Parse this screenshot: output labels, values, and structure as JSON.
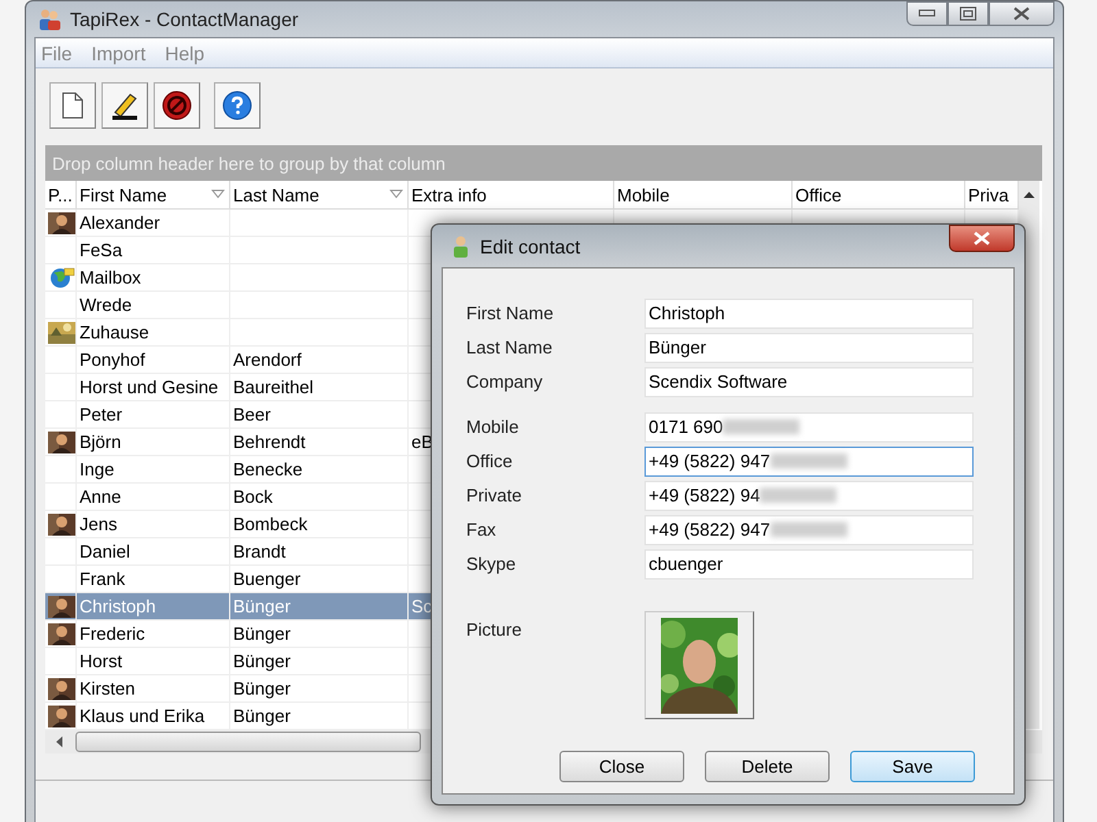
{
  "window": {
    "title": "TapiRex - ContactManager"
  },
  "menu": [
    "File",
    "Import",
    "Help"
  ],
  "toolbar": [
    {
      "kind": "new"
    },
    {
      "kind": "edit"
    },
    {
      "kind": "delete"
    },
    {
      "kind": "help"
    }
  ],
  "grid": {
    "group_hint": "Drop column header here to group by that column",
    "columns": [
      {
        "label": "P...",
        "filter": false
      },
      {
        "label": "First Name",
        "filter": true
      },
      {
        "label": "Last Name",
        "filter": true
      },
      {
        "label": "Extra info",
        "filter": false
      },
      {
        "label": "Mobile",
        "filter": false
      },
      {
        "label": "Office",
        "filter": false
      },
      {
        "label": "Priva",
        "filter": false
      }
    ],
    "rows": [
      {
        "kind": "person",
        "first_name": "Alexander",
        "selected": false
      },
      {
        "kind": "plain",
        "first_name": "FeSa",
        "selected": false
      },
      {
        "kind": "globe",
        "first_name": "Mailbox",
        "selected": false
      },
      {
        "kind": "plain",
        "first_name": "Wrede",
        "selected": false
      },
      {
        "kind": "scene",
        "first_name": "Zuhause",
        "selected": false
      },
      {
        "kind": "plain",
        "first_name": "Ponyhof",
        "last_name": "Arendorf",
        "selected": false
      },
      {
        "kind": "plain",
        "first_name": "Horst und Gesine",
        "last_name": "Baureithel",
        "selected": false
      },
      {
        "kind": "plain",
        "first_name": "Peter",
        "last_name": "Beer",
        "selected": false
      },
      {
        "kind": "person",
        "first_name": "Björn",
        "last_name": "Behrendt",
        "extra_info": "eB",
        "selected": false
      },
      {
        "kind": "plain",
        "first_name": "Inge",
        "last_name": "Benecke",
        "selected": false
      },
      {
        "kind": "plain",
        "first_name": "Anne",
        "last_name": "Bock",
        "selected": false
      },
      {
        "kind": "person",
        "first_name": "Jens",
        "last_name": "Bombeck",
        "selected": false
      },
      {
        "kind": "plain",
        "first_name": "Daniel",
        "last_name": "Brandt",
        "selected": false
      },
      {
        "kind": "plain",
        "first_name": "Frank",
        "last_name": "Buenger",
        "selected": false
      },
      {
        "kind": "person",
        "first_name": "Christoph",
        "last_name": "Bünger",
        "extra_info": "Sc",
        "selected": true
      },
      {
        "kind": "person",
        "first_name": "Frederic",
        "last_name": "Bünger",
        "selected": false
      },
      {
        "kind": "plain",
        "first_name": "Horst",
        "last_name": "Bünger",
        "selected": false
      },
      {
        "kind": "person",
        "first_name": "Kirsten",
        "last_name": "Bünger",
        "selected": false
      },
      {
        "kind": "person",
        "first_name": "Klaus und Erika",
        "last_name": "Bünger",
        "selected": false
      }
    ]
  },
  "dialog": {
    "title": "Edit contact",
    "sections": [
      [
        {
          "label": "First Name",
          "value": "Christoph",
          "focused": false,
          "redacted": false
        },
        {
          "label": "Last Name",
          "value": "Bünger",
          "focused": false,
          "redacted": false
        },
        {
          "label": "Company",
          "value": "Scendix Software",
          "focused": false,
          "redacted": false
        }
      ],
      [
        {
          "label": "Mobile",
          "value": "0171 690",
          "focused": false,
          "redacted": true
        },
        {
          "label": "Office",
          "value": "+49 (5822) 947",
          "focused": true,
          "redacted": true
        },
        {
          "label": "Private",
          "value": "+49 (5822) 94",
          "focused": false,
          "redacted": true
        },
        {
          "label": "Fax",
          "value": "+49 (5822) 947",
          "focused": false,
          "redacted": true
        },
        {
          "label": "Skype",
          "value": "cbuenger",
          "focused": false,
          "redacted": false
        }
      ]
    ],
    "picture_label": "Picture",
    "buttons": [
      {
        "label": "Close",
        "default": false
      },
      {
        "label": "Delete",
        "default": false
      },
      {
        "label": "Save",
        "default": true
      }
    ]
  }
}
